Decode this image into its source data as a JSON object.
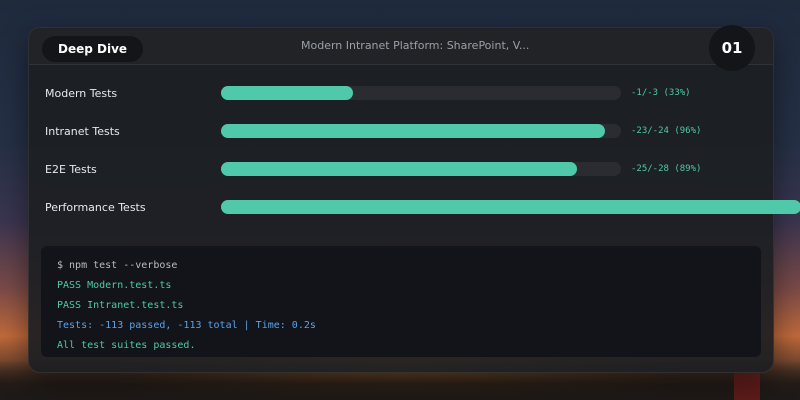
{
  "header": {
    "tag_label": "Deep Dive",
    "title": "Modern Intranet Platform: SharePoint, V...",
    "badge": "01"
  },
  "bars": [
    {
      "label": "Modern Tests",
      "value_text": "-1/-3 (33%)",
      "fraction": 0.33
    },
    {
      "label": "Intranet Tests",
      "value_text": "-23/-24 (96%)",
      "fraction": 0.96
    },
    {
      "label": "E2E Tests",
      "value_text": "-25/-28 (89%)",
      "fraction": 0.89
    },
    {
      "label": "Performance Tests",
      "value_text": "",
      "fraction": 1.45
    }
  ],
  "terminal": {
    "lines": [
      {
        "text": "$ npm test --verbose",
        "kind": "cmd"
      },
      {
        "text": "PASS Modern.test.ts",
        "kind": "pass"
      },
      {
        "text": "PASS Intranet.test.ts",
        "kind": "pass"
      },
      {
        "text": "Tests: -113 passed, -113 total | Time: 0.2s",
        "kind": "stats"
      },
      {
        "text": "All test suites passed.",
        "kind": "ok"
      }
    ]
  },
  "colors": {
    "accent": "#4fc9a9",
    "stats": "#5aa2e8",
    "card_bg": "#1c1e22"
  }
}
